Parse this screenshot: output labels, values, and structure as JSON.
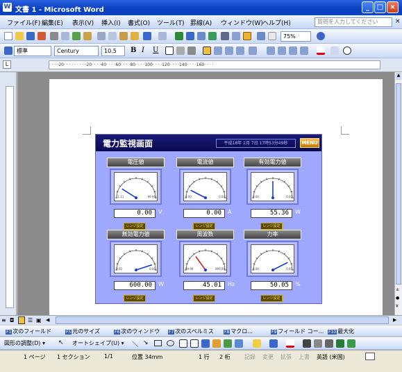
{
  "window": {
    "title": "文書 1 - Microsoft Word"
  },
  "menubar": {
    "items": [
      "ファイル(F)",
      "編集(E)",
      "表示(V)",
      "挿入(I)",
      "書式(O)",
      "ツール(T)",
      "罫線(A)",
      "ウィンドウ(W)",
      "ヘルプ(H)"
    ],
    "help_placeholder": "質問を入力してください"
  },
  "toolbar": {
    "zoom": "75%",
    "style": "標準",
    "font": "Century",
    "size": "10.5"
  },
  "ruler": {
    "scale": "· · · ·20· · · · · ·  · · ·20· · · ·40· · · ·60· · · ·80· · · ·100· · · ·120· · · ·140· · · ·160· · · ·"
  },
  "hmi": {
    "title": "電力監視画面",
    "datetime": "平成18年 2月 7日 17時53分49秒",
    "menu_label": "MENU",
    "range_label": "レンジ設定",
    "meters": [
      {
        "title": "電圧値",
        "value": "0.00",
        "unit": "V",
        "min": "11.11",
        "max": "99.99",
        "needle": 0.18
      },
      {
        "title": "電流値",
        "value": "0.00",
        "unit": "A",
        "min": "0.00",
        "max": "0.00",
        "needle": 0.15
      },
      {
        "title": "有効電力値",
        "value": "55.36",
        "unit": "W",
        "min": "0.00",
        "max": "0.00",
        "needle": 0.5
      },
      {
        "title": "無効電力値",
        "value": "600.00",
        "unit": "W",
        "min": "0.00",
        "max": "0.00",
        "needle": 0.9
      },
      {
        "title": "周波数",
        "value": "45.01",
        "unit": "Hz",
        "min": "99.99",
        "max": "999.99",
        "needle": 0.3
      },
      {
        "title": "力率",
        "value": "50.05",
        "unit": "%",
        "min": "0.00",
        "max": "0.00",
        "needle": 0.85
      }
    ]
  },
  "fkeys": [
    {
      "key": "F1",
      "label": "次のフィールド"
    },
    {
      "key": "F5",
      "label": "元のサイズ"
    },
    {
      "key": "F6",
      "label": "次のウィンドウ"
    },
    {
      "key": "F7",
      "label": "次のスペルミス"
    },
    {
      "key": "F8",
      "label": "マクロ..."
    },
    {
      "key": "F9",
      "label": "フィールド コー..."
    },
    {
      "key": "F10",
      "label": "最大化"
    }
  ],
  "drawing": {
    "draw_label": "図形の調整(D) ▾",
    "autoshape_label": "オートシェイプ(U) ▾"
  },
  "status": {
    "page": "1 ページ",
    "section": "1 セクション",
    "pages": "1/1",
    "position": "位置 34mm",
    "line": "1 行",
    "col": "2 桁",
    "rec": "記録",
    "trk": "変更",
    "ext": "拡張",
    "ovr": "上書",
    "lang": "英語 (米国)"
  }
}
